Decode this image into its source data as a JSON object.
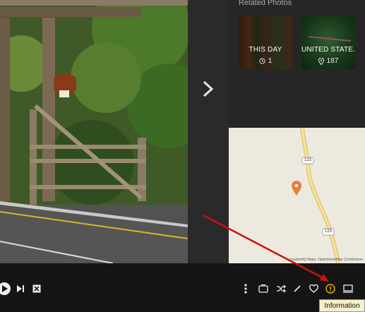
{
  "related": {
    "title": "Related Photos",
    "tiles": [
      {
        "label": "THIS DAY",
        "icon": "clock-icon",
        "count": "1"
      },
      {
        "label": "UNITED STATE...",
        "icon": "location-pin-icon",
        "count": "187"
      }
    ]
  },
  "map": {
    "attribution": "LocationIQ Maps, OpenStreetMap Contributors",
    "route_labels": [
      "123",
      "123"
    ]
  },
  "toolbar": {
    "left": [
      "play-icon",
      "skip-next-icon",
      "close-icon"
    ],
    "right": [
      "more-vertical-icon",
      "slideshow-icon",
      "shuffle-icon",
      "edit-icon",
      "heart-icon",
      "info-icon",
      "cast-icon"
    ],
    "highlight_color": "#f0b400"
  },
  "tooltip": {
    "text": "Information"
  },
  "annotation": {
    "arrow_color": "#d01010"
  }
}
